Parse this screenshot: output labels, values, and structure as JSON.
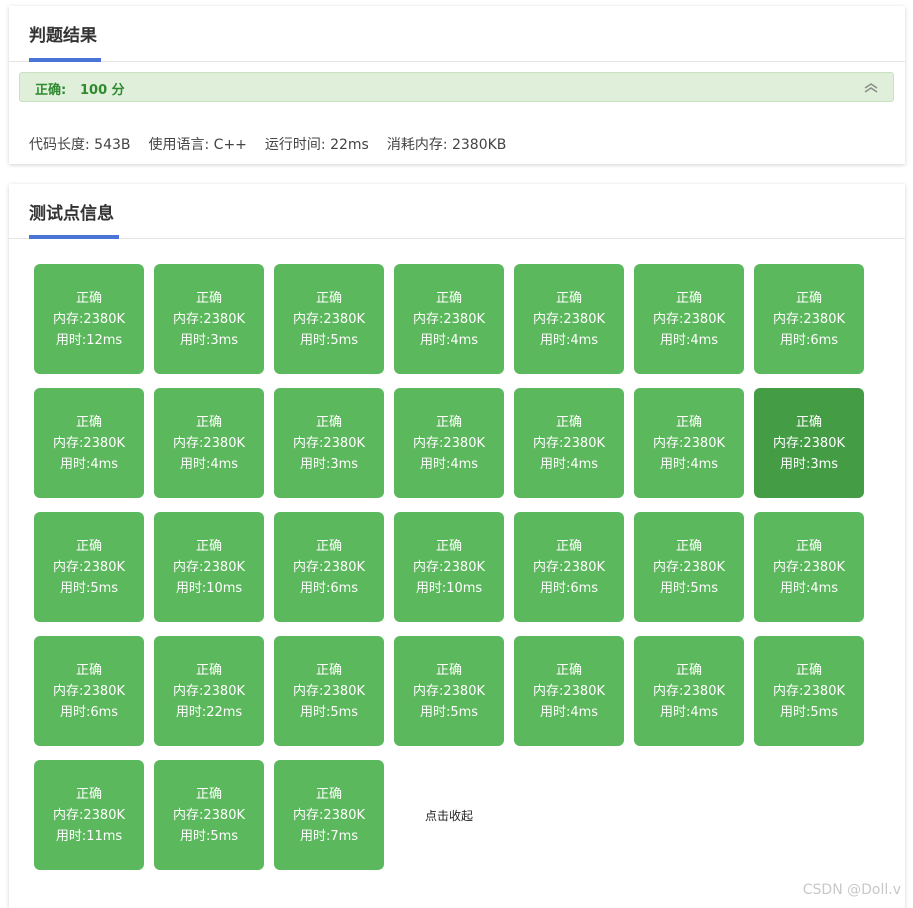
{
  "result_card": {
    "title": "判题结果",
    "status_label": "正确:",
    "score": "100 分",
    "stats": [
      "代码长度: 543B",
      "使用语言: C++",
      "运行时间: 22ms",
      "消耗内存: 2380KB"
    ]
  },
  "testcase_card": {
    "title": "测试点信息",
    "collapse_link": "点击收起",
    "testcases": [
      {
        "status": "正确",
        "memory": "内存:2380K",
        "time": "用时:12ms"
      },
      {
        "status": "正确",
        "memory": "内存:2380K",
        "time": "用时:3ms"
      },
      {
        "status": "正确",
        "memory": "内存:2380K",
        "time": "用时:5ms"
      },
      {
        "status": "正确",
        "memory": "内存:2380K",
        "time": "用时:4ms"
      },
      {
        "status": "正确",
        "memory": "内存:2380K",
        "time": "用时:4ms"
      },
      {
        "status": "正确",
        "memory": "内存:2380K",
        "time": "用时:4ms"
      },
      {
        "status": "正确",
        "memory": "内存:2380K",
        "time": "用时:6ms"
      },
      {
        "status": "正确",
        "memory": "内存:2380K",
        "time": "用时:4ms"
      },
      {
        "status": "正确",
        "memory": "内存:2380K",
        "time": "用时:4ms"
      },
      {
        "status": "正确",
        "memory": "内存:2380K",
        "time": "用时:3ms"
      },
      {
        "status": "正确",
        "memory": "内存:2380K",
        "time": "用时:4ms"
      },
      {
        "status": "正确",
        "memory": "内存:2380K",
        "time": "用时:4ms"
      },
      {
        "status": "正确",
        "memory": "内存:2380K",
        "time": "用时:4ms"
      },
      {
        "status": "正确",
        "memory": "内存:2380K",
        "time": "用时:3ms"
      },
      {
        "status": "正确",
        "memory": "内存:2380K",
        "time": "用时:5ms"
      },
      {
        "status": "正确",
        "memory": "内存:2380K",
        "time": "用时:10ms"
      },
      {
        "status": "正确",
        "memory": "内存:2380K",
        "time": "用时:6ms"
      },
      {
        "status": "正确",
        "memory": "内存:2380K",
        "time": "用时:10ms"
      },
      {
        "status": "正确",
        "memory": "内存:2380K",
        "time": "用时:6ms"
      },
      {
        "status": "正确",
        "memory": "内存:2380K",
        "time": "用时:5ms"
      },
      {
        "status": "正确",
        "memory": "内存:2380K",
        "time": "用时:4ms"
      },
      {
        "status": "正确",
        "memory": "内存:2380K",
        "time": "用时:6ms"
      },
      {
        "status": "正确",
        "memory": "内存:2380K",
        "time": "用时:22ms"
      },
      {
        "status": "正确",
        "memory": "内存:2380K",
        "time": "用时:5ms"
      },
      {
        "status": "正确",
        "memory": "内存:2380K",
        "time": "用时:5ms"
      },
      {
        "status": "正确",
        "memory": "内存:2380K",
        "time": "用时:4ms"
      },
      {
        "status": "正确",
        "memory": "内存:2380K",
        "time": "用时:4ms"
      },
      {
        "status": "正确",
        "memory": "内存:2380K",
        "time": "用时:5ms"
      },
      {
        "status": "正确",
        "memory": "内存:2380K",
        "time": "用时:11ms"
      },
      {
        "status": "正确",
        "memory": "内存:2380K",
        "time": "用时:5ms"
      },
      {
        "status": "正确",
        "memory": "内存:2380K",
        "time": "用时:7ms"
      }
    ],
    "hovered_index": 13
  },
  "watermark": "CSDN @Doll.v",
  "colors": {
    "accepted": "#5cb85c",
    "accepted_hover": "#449d44",
    "accent_underline": "#4a75d6",
    "success_bg": "#dfefda",
    "success_text": "#2f8a2f"
  },
  "icons": {
    "collapse": "double-chevron-up-icon"
  }
}
